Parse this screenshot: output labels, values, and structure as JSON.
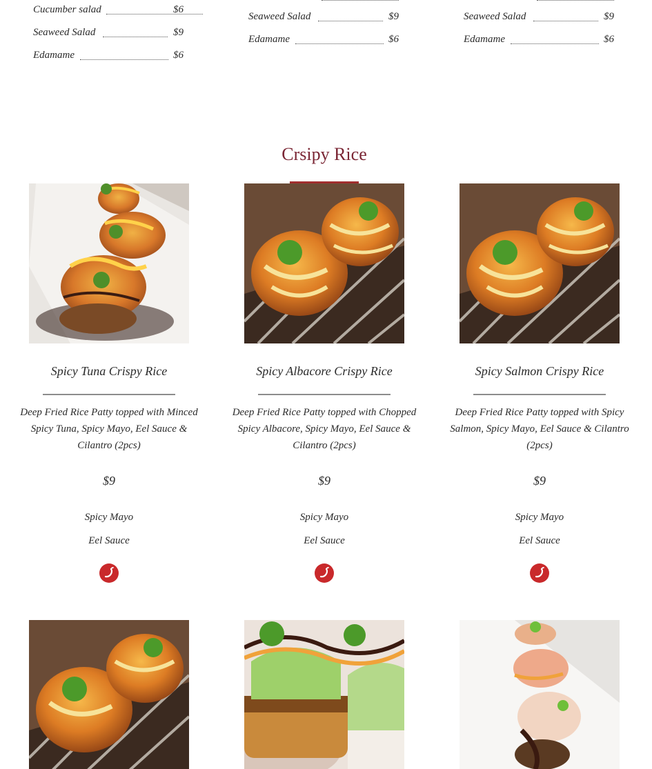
{
  "menu_columns": [
    {
      "items": [
        {
          "name": "Cucumber salad",
          "price": "$6"
        },
        {
          "name": "Seaweed Salad",
          "price": "$9"
        },
        {
          "name": "Edamame",
          "price": "$6"
        }
      ]
    },
    {
      "items": [
        {
          "name": "Seaweed Salad",
          "price": "$9"
        },
        {
          "name": "Edamame",
          "price": "$6"
        }
      ]
    },
    {
      "items": [
        {
          "name": "Seaweed Salad",
          "price": "$9"
        },
        {
          "name": "Edamame",
          "price": "$6"
        }
      ]
    }
  ],
  "section": {
    "title": "Crsipy Rice",
    "accent_color": "#7a2634"
  },
  "cards": [
    {
      "name": "Spicy Tuna Crispy Rice",
      "description": "Deep Fried Rice Patty topped with Minced Spicy Tuna, Spicy Mayo, Eel Sauce & Cilantro (2pcs)",
      "price": "$9",
      "sauces": [
        "Spicy Mayo",
        "Eel Sauce"
      ],
      "badge_icon": "chili-pepper-icon"
    },
    {
      "name": "Spicy Albacore Crispy Rice",
      "description": "Deep Fried Rice Patty topped with Chopped Spicy Albacore, Spicy Mayo, Eel Sauce & Cilantro (2pcs)",
      "price": "$9",
      "sauces": [
        "Spicy Mayo",
        "Eel Sauce"
      ],
      "badge_icon": "chili-pepper-icon"
    },
    {
      "name": "Spicy Salmon Crispy Rice",
      "description": "Deep Fried Rice Patty topped with Spicy Salmon, Spicy Mayo, Eel Sauce & Cilantro (2pcs)",
      "price": "$9",
      "sauces": [
        "Spicy Mayo",
        "Eel Sauce"
      ],
      "badge_icon": "chili-pepper-icon"
    }
  ],
  "badge_color": "#c9292b"
}
